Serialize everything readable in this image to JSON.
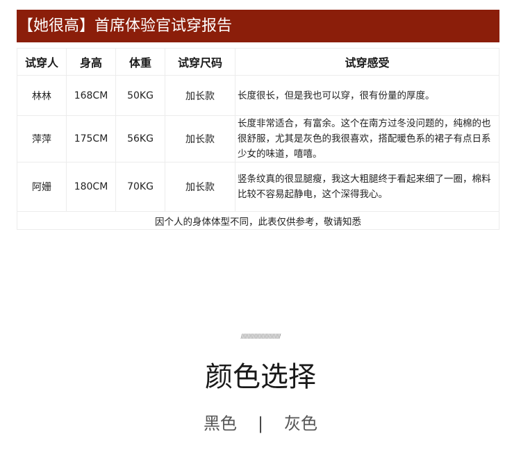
{
  "banner": {
    "title": "【她很高】首席体验官试穿报告"
  },
  "table": {
    "headers": [
      "试穿人",
      "身高",
      "体重",
      "试穿尺码",
      "试穿感受"
    ],
    "rows": [
      {
        "name": "林林",
        "height": "168CM",
        "weight": "50KG",
        "size": "加长款",
        "feedback": "长度很长，但是我也可以穿，很有份量的厚度。"
      },
      {
        "name": "萍萍",
        "height": "175CM",
        "weight": "56KG",
        "size": "加长款",
        "feedback": "长度非常适合，有富余。这个在南方过冬没问题的，纯棉的也很舒服，尤其是灰色的我很喜欢，搭配暖色系的裙子有点日系少女的味道，嘻嘻。"
      },
      {
        "name": "阿姗",
        "height": "180CM",
        "weight": "70KG",
        "size": "加长款",
        "feedback": "竖条纹真的很显腿瘦，我这大粗腿终于看起来细了一圈，棉料比较不容易起静电，这个深得我心。"
      }
    ],
    "note": "因个人的身体体型不同，此表仅供参考，敬请知悉"
  },
  "section": {
    "decoration": "////////////////////////////",
    "title": "颜色选择",
    "colors": [
      "黑色",
      "灰色"
    ],
    "separator": "|"
  },
  "theme": {
    "banner_color": "#8b1e0a"
  }
}
